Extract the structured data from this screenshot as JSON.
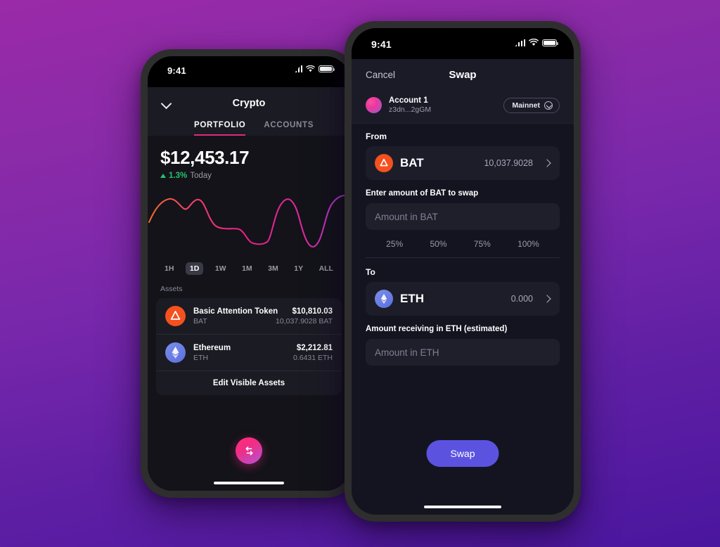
{
  "background": {
    "from": "#9a2aa8",
    "to": "#4a169e"
  },
  "phone_portfolio": {
    "status": {
      "time": "9:41",
      "signal_icon": "cellular-bars-icon",
      "wifi_icon": "wifi-icon",
      "battery_icon": "battery-icon"
    },
    "nav": {
      "collapse_icon": "chevron-down-icon",
      "title": "Crypto"
    },
    "tabs": [
      {
        "label": "PORTFOLIO",
        "active": true
      },
      {
        "label": "ACCOUNTS",
        "active": false
      }
    ],
    "balance": {
      "amount": "$12,453.17",
      "change": "1.3%",
      "period": "Today",
      "direction_icon": "triangle-up-icon",
      "change_color": "#25c26e"
    },
    "ranges": [
      {
        "label": "1H",
        "active": false
      },
      {
        "label": "1D",
        "active": true
      },
      {
        "label": "1W",
        "active": false
      },
      {
        "label": "1M",
        "active": false
      },
      {
        "label": "3M",
        "active": false
      },
      {
        "label": "1Y",
        "active": false
      },
      {
        "label": "ALL",
        "active": false
      }
    ],
    "assets_label": "Assets",
    "assets": [
      {
        "icon": "bat-coin-icon",
        "name": "Basic Attention Token",
        "symbol": "BAT",
        "fiat": "$10,810.03",
        "qty": "10,037.9028 BAT"
      },
      {
        "icon": "eth-coin-icon",
        "name": "Ethereum",
        "symbol": "ETH",
        "fiat": "$2,212.81",
        "qty": "0.6431 ETH"
      }
    ],
    "edit_assets_label": "Edit Visible Assets",
    "fab": {
      "icon": "swap-arrows-icon"
    }
  },
  "phone_swap": {
    "status": {
      "time": "9:41",
      "signal_icon": "cellular-bars-icon",
      "wifi_icon": "wifi-icon",
      "battery_icon": "battery-icon"
    },
    "nav": {
      "cancel_label": "Cancel",
      "title": "Swap"
    },
    "account": {
      "name": "Account 1",
      "address": "z3dn...2gGM",
      "avatar_icon": "account-avatar-icon"
    },
    "network": {
      "label": "Mainnet",
      "chevron_icon": "chevron-down-circle-icon"
    },
    "from": {
      "label": "From",
      "token_symbol": "BAT",
      "token_icon": "bat-coin-icon",
      "token_balance": "10,037.9028",
      "chevron_icon": "chevron-right-icon",
      "input_label": "Enter amount of BAT to swap",
      "input_value": "",
      "input_placeholder": "Amount in BAT"
    },
    "percents": [
      "25%",
      "50%",
      "75%",
      "100%"
    ],
    "to": {
      "label": "To",
      "token_symbol": "ETH",
      "token_icon": "eth-coin-icon",
      "token_balance": "0.000",
      "chevron_icon": "chevron-right-icon",
      "input_label": "Amount receiving in ETH (estimated)",
      "input_value": "",
      "input_placeholder": "Amount in ETH"
    },
    "submit": {
      "label": "Swap",
      "color": "#5b53e0"
    }
  },
  "chart_data": {
    "type": "line",
    "title": "",
    "xlabel": "",
    "ylabel": "",
    "x": [
      0,
      1,
      2,
      3,
      4,
      5,
      6,
      7,
      8,
      9,
      10,
      11,
      12,
      13,
      14,
      15,
      16,
      17,
      18
    ],
    "values": [
      52,
      74,
      82,
      70,
      80,
      58,
      42,
      40,
      40,
      22,
      20,
      28,
      76,
      80,
      58,
      18,
      62,
      82,
      84
    ],
    "ylim": [
      0,
      100
    ],
    "grid": false,
    "legend": "none",
    "gradient": [
      "#f06a2a",
      "#e81f86",
      "#a33cd9"
    ]
  }
}
